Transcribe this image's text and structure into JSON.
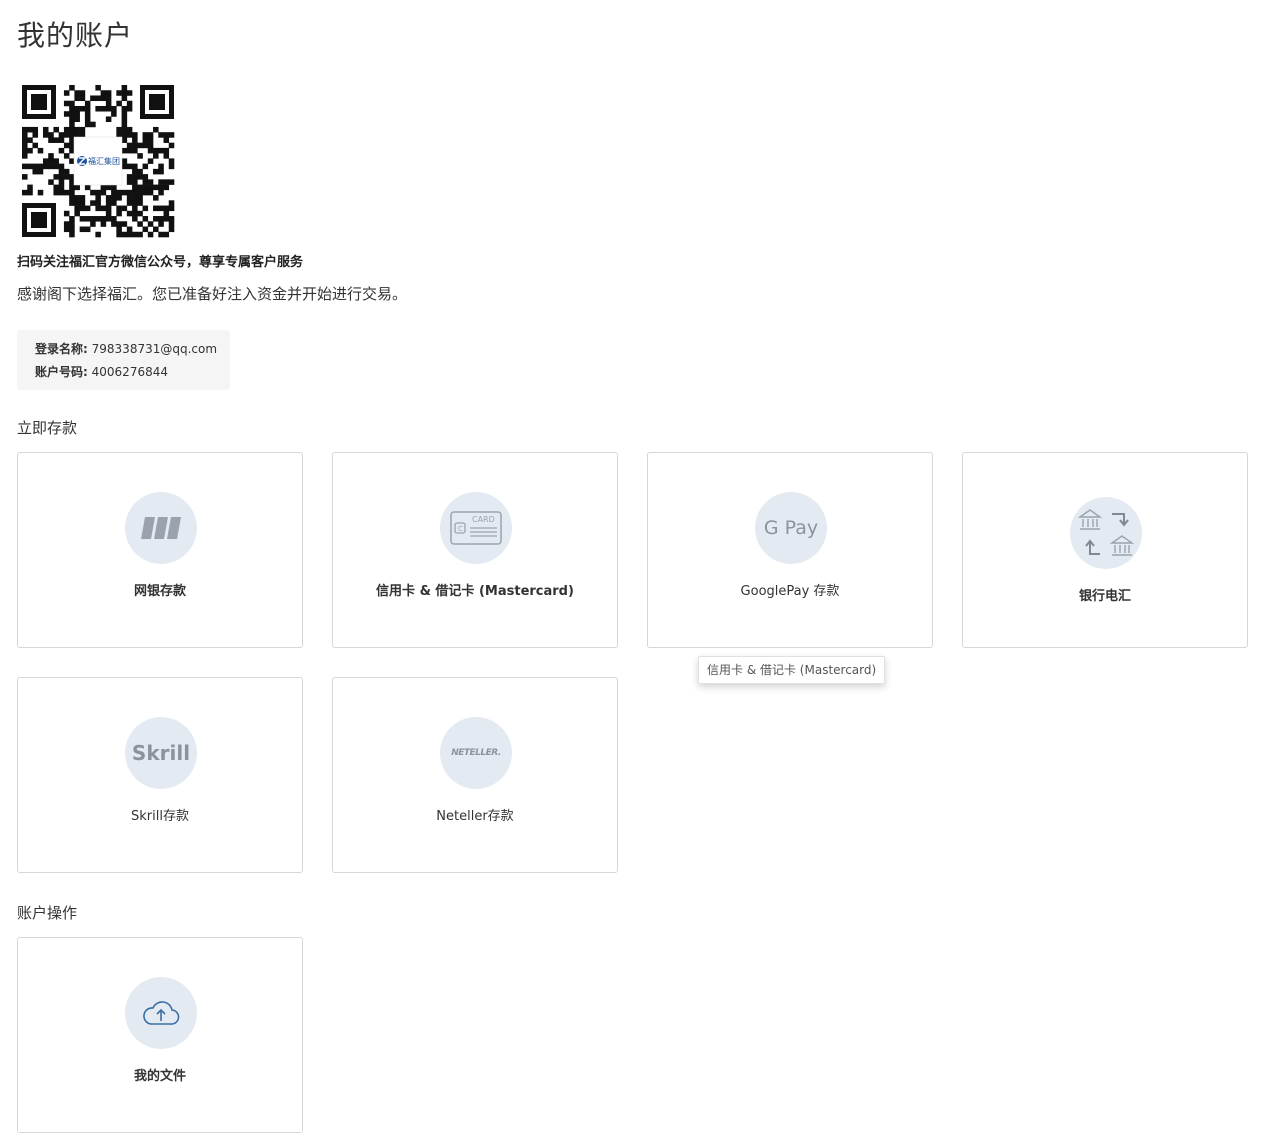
{
  "page": {
    "title": "我的账户"
  },
  "qr": {
    "logo_text": "福汇集团",
    "caption": "扫码关注福汇官方微信公众号，尊享专属客户服务"
  },
  "intro": "感谢阁下选择福汇。您已准备好注入资金并开始进行交易。",
  "account": {
    "login_label": "登录名称:",
    "login_value": "798338731@qq.com",
    "number_label": "账户号码:",
    "number_value": "4006276844"
  },
  "deposit": {
    "title": "立即存款",
    "options": [
      {
        "label": "网银存款",
        "icon": "online-banking-icon"
      },
      {
        "label": "信用卡 & 借记卡 (Mastercard)",
        "icon": "credit-card-icon",
        "icon_text": "CARD"
      },
      {
        "label": "GooglePay 存款",
        "icon": "google-pay-icon",
        "icon_text": "G Pay"
      },
      {
        "label": "银行电汇",
        "icon": "bank-transfer-icon"
      },
      {
        "label": "Skrill存款",
        "icon": "skrill-icon",
        "icon_text": "Skrill"
      },
      {
        "label": "Neteller存款",
        "icon": "neteller-icon",
        "icon_text": "NETELLER."
      }
    ]
  },
  "tooltip": "信用卡 & 借记卡 (Mastercard)",
  "operations": {
    "title": "账户操作",
    "options": [
      {
        "label": "我的文件",
        "icon": "cloud-upload-icon"
      }
    ]
  },
  "colors": {
    "icon_circle": "#e4eaf2",
    "icon_gray": "#9aa3ad",
    "cloud_blue": "#3a6ea5",
    "card_border": "#d6d6d6",
    "info_bg": "#f5f5f5"
  }
}
